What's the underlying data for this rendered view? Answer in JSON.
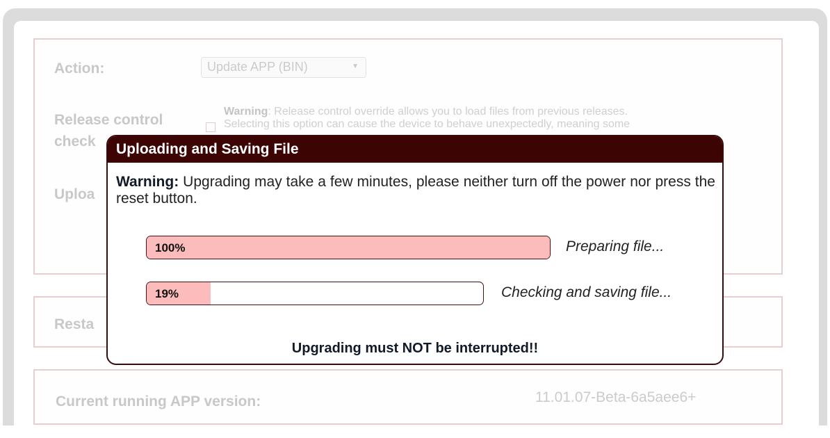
{
  "form": {
    "action_label": "Action:",
    "action_select_value": "Update APP (BIN)",
    "release_control_label_line1": "Release control",
    "release_control_label_line2": "check",
    "release_note_bold": "Warning",
    "release_note_line1": ": Release control override allows you to load files from previous releases.",
    "release_note_line2": "Selecting this option can cause the device to behave unexpectedly, meaning some",
    "upload_label": "Uploa",
    "restart_label": "Resta",
    "current_version_label": "Current running APP version:",
    "current_version_value": "11.01.07-Beta-6a5aee6+"
  },
  "modal": {
    "title": "Uploading and Saving File",
    "warning_bold": "Warning:",
    "warning_text": " Upgrading may take a few minutes, please neither turn off the power nor press the reset button.",
    "progress": [
      {
        "label": "100%",
        "percent": 100,
        "status": "Preparing file..."
      },
      {
        "label": "19%",
        "percent": 19,
        "status": "Checking and saving file..."
      }
    ],
    "footer": "Upgrading must NOT be interrupted!!"
  },
  "colors": {
    "modal_header_bg": "#3d0404",
    "progress_fill": "#fdbcbc"
  },
  "icons": {
    "select_caret": "chevron-down-icon"
  }
}
